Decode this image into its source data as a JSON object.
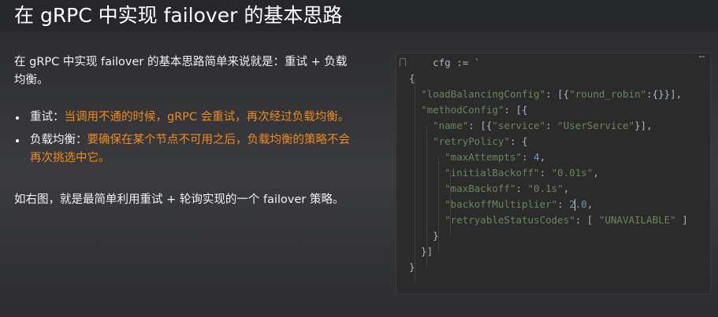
{
  "title": "在 gRPC 中实现 failover 的基本思路",
  "intro": "在 gRPC 中实现 failover 的基本思路简单来说就是：重试 + 负载均衡。",
  "bullets": [
    {
      "label": "重试：",
      "text": "当调用不通的时候，gRPC 会重试，再次经过负载均衡。"
    },
    {
      "label": "负载均衡：",
      "text": "要确保在某个节点不可用之后，负载均衡的策略不会再次挑选中它。"
    }
  ],
  "conclusion": "如右图，就是最简单利用重试 + 轮询实现的一个 failover 策略。",
  "code": {
    "lines": [
      "    cfg := `",
      "{",
      "  \"loadBalancingConfig\": [{\"round_robin\":{}}],",
      "  \"methodConfig\": [{",
      "    \"name\": [{\"service\": \"UserService\"}],",
      "    \"retryPolicy\": {",
      "      \"maxAttempts\": 4,",
      "      \"initialBackoff\": \"0.01s\",",
      "      \"maxBackoff\": \"0.1s\",",
      "      \"backoffMultiplier\": 2.0,",
      "      \"retryableStatusCodes\": [ \"UNAVAILABLE\" ]",
      "    }",
      "  }]",
      "}"
    ]
  },
  "colors": {
    "highlight": "#f28a1c",
    "code_bg": "#2b2b2b",
    "code_text": "#a9b7c6"
  }
}
